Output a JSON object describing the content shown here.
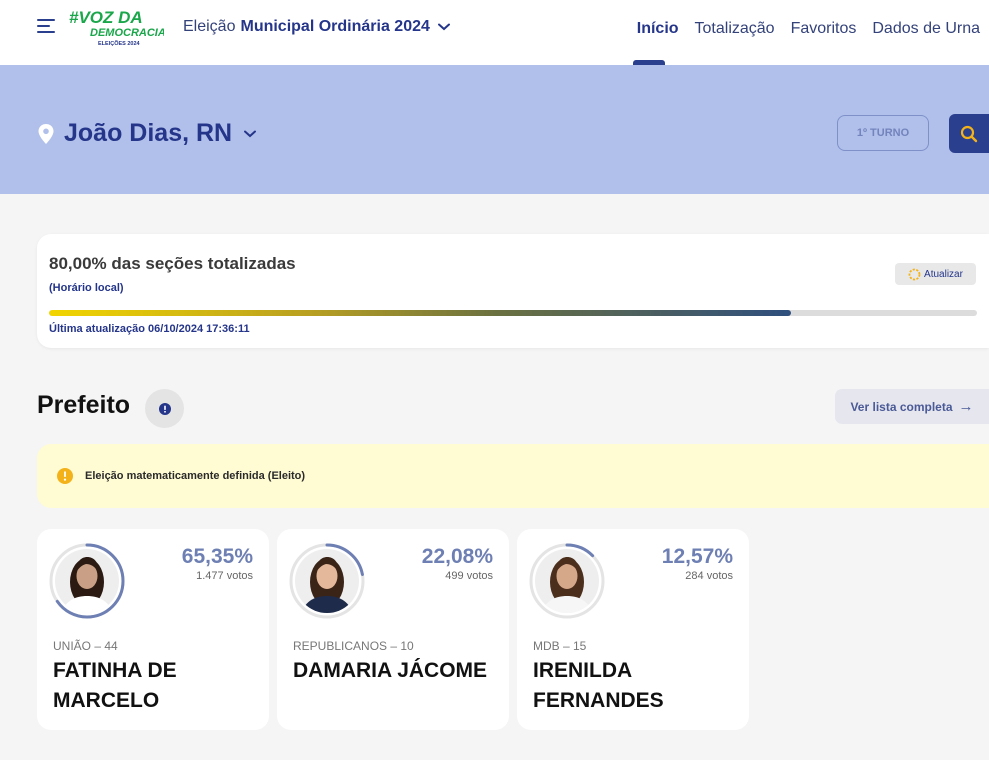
{
  "header": {
    "logo_line1": "#VOZ DA",
    "logo_line2": "DEMOCRACIA",
    "logo_line3": "ELEIÇÕES 2024",
    "election_prefix": "Eleição",
    "election_name": "Municipal Ordinária 2024",
    "nav": [
      "Início",
      "Totalização",
      "Favoritos",
      "Dados de Urna"
    ],
    "active_nav": "Início"
  },
  "banner": {
    "location": "João Dias, RN",
    "turno": "1º TURNO"
  },
  "progress": {
    "title": "80,00% das seções totalizadas",
    "subtitle": "(Horário local)",
    "refresh_label": "Atualizar",
    "percent": 80,
    "last_update": "Última atualização 06/10/2024 17:36:11"
  },
  "section": {
    "title": "Prefeito",
    "full_list_label": "Ver lista completa",
    "alert_text": "Eleição matematicamente definida (Eleito)"
  },
  "candidates": [
    {
      "party": "UNIÃO – 44",
      "name": "FATINHA DE MARCELO",
      "percent": "65,35%",
      "votes": "1.477 votos",
      "ring": 65.35,
      "ring_color": "#6d7fb3",
      "hair_color": "#2a1a12",
      "skin_color": "#c9a085",
      "top_color": "#ffffff"
    },
    {
      "party": "REPUBLICANOS – 10",
      "name": "DAMARIA JÁCOME",
      "percent": "22,08%",
      "votes": "499 votos",
      "ring": 22.08,
      "ring_color": "#6d7fb3",
      "hair_color": "#3a2418",
      "skin_color": "#e4b89a",
      "top_color": "#1e2b4a"
    },
    {
      "party": "MDB – 15",
      "name": "IRENILDA FERNANDES",
      "percent": "12,57%",
      "votes": "284 votos",
      "ring": 12.57,
      "ring_color": "#6d7fb3",
      "hair_color": "#4b2e1c",
      "skin_color": "#d6a88a",
      "top_color": "#f6f6f6"
    }
  ],
  "colors": {
    "primary": "#24358a",
    "banner": "#b1c0ea",
    "alert_bg": "#fffbd2",
    "warn": "#f3b21a",
    "logo_green": "#1aa64a"
  }
}
